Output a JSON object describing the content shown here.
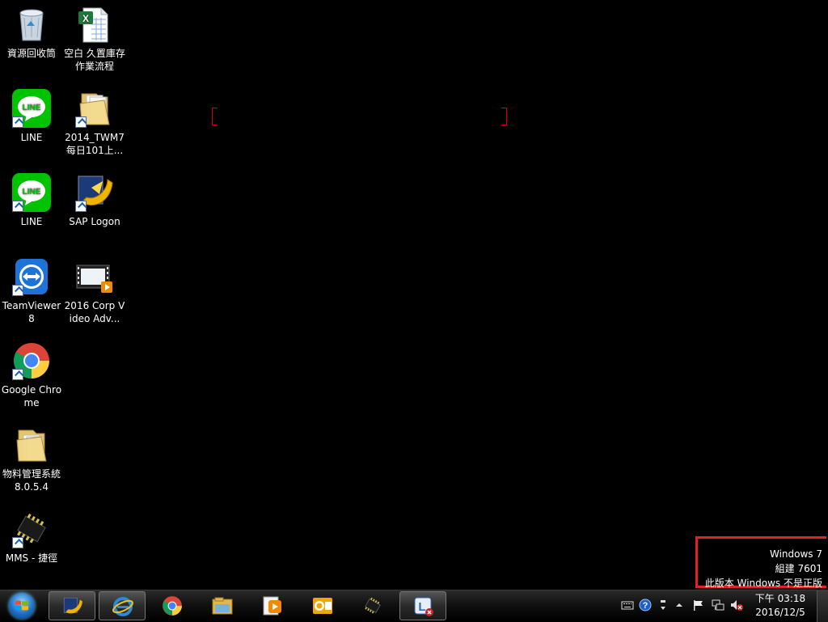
{
  "desktop": {
    "icons": [
      {
        "label": "資源回收筒",
        "icon": "recycle-bin-icon"
      },
      {
        "label": "空白 久置庫存作業流程",
        "icon": "excel-file-icon"
      },
      {
        "label": "LINE",
        "icon": "line-app-icon"
      },
      {
        "label": "2014_TWM7每日101上...",
        "icon": "folder-icon"
      },
      {
        "label": "LINE",
        "icon": "line-app-icon"
      },
      {
        "label": "SAP Logon",
        "icon": "sap-logon-icon"
      },
      {
        "label": "TeamViewer 8",
        "icon": "teamviewer-icon"
      },
      {
        "label": "2016 Corp Video Adv...",
        "icon": "video-file-icon"
      },
      {
        "label": "Google Chrome",
        "icon": "chrome-icon"
      },
      {
        "label": "物料管理系統 8.0.5.4",
        "icon": "folder-icon"
      },
      {
        "label": "MMS - 捷徑",
        "icon": "chip-icon"
      }
    ]
  },
  "watermark": {
    "line1": "Windows 7",
    "line2": "組建 7601",
    "line3": "此版本 Windows 不是正版",
    "highlight_color": "#e0202a"
  },
  "taskbar": {
    "start": "start-button",
    "pinned": [
      {
        "icon": "sap-logon-icon",
        "active": true
      },
      {
        "icon": "internet-explorer-icon",
        "active": true
      },
      {
        "icon": "chrome-icon",
        "active": false
      },
      {
        "icon": "file-explorer-icon",
        "active": false
      },
      {
        "icon": "media-player-icon",
        "active": false
      },
      {
        "icon": "outlook-icon",
        "active": false
      },
      {
        "icon": "chip-icon",
        "active": false
      },
      {
        "icon": "lync-icon",
        "active": true
      }
    ],
    "tray": {
      "clock_time": "下午 03:18",
      "clock_date": "2016/12/5"
    }
  }
}
